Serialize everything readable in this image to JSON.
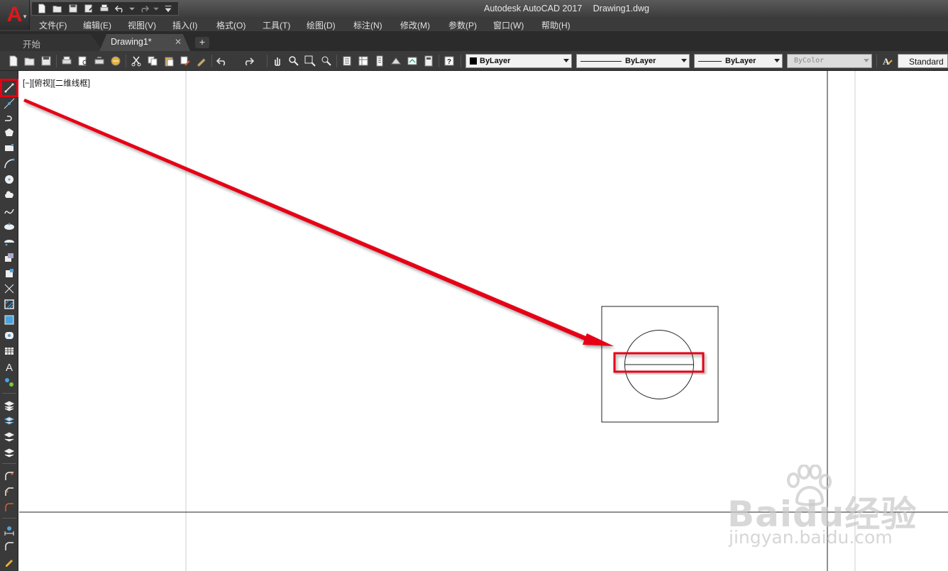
{
  "title_bar": {
    "app_name": "Autodesk AutoCAD 2017",
    "file_name": "Drawing1.dwg",
    "app_button_letter": "A"
  },
  "menu": [
    "文件(F)",
    "编辑(E)",
    "视图(V)",
    "插入(I)",
    "格式(O)",
    "工具(T)",
    "绘图(D)",
    "标注(N)",
    "修改(M)",
    "参数(P)",
    "窗口(W)",
    "帮助(H)"
  ],
  "tabs": {
    "start": "开始",
    "drawing": "Drawing1*",
    "close_glyph": "✕",
    "add_glyph": "+"
  },
  "properties": {
    "color": "ByLayer",
    "linetype": "ByLayer",
    "lineweight": "ByLayer",
    "plotstyle": "ByColor",
    "text_style": "Standard"
  },
  "viewport_label": "[−][俯视][二维线框]",
  "watermark": {
    "brand": "Baidu经验",
    "url": "jingyan.baidu.com"
  },
  "colors": {
    "accent_red": "#e60012",
    "ui_dark": "#3a3a3a",
    "canvas": "#ffffff"
  },
  "icons": {
    "highlighted_tool": "line-icon"
  }
}
